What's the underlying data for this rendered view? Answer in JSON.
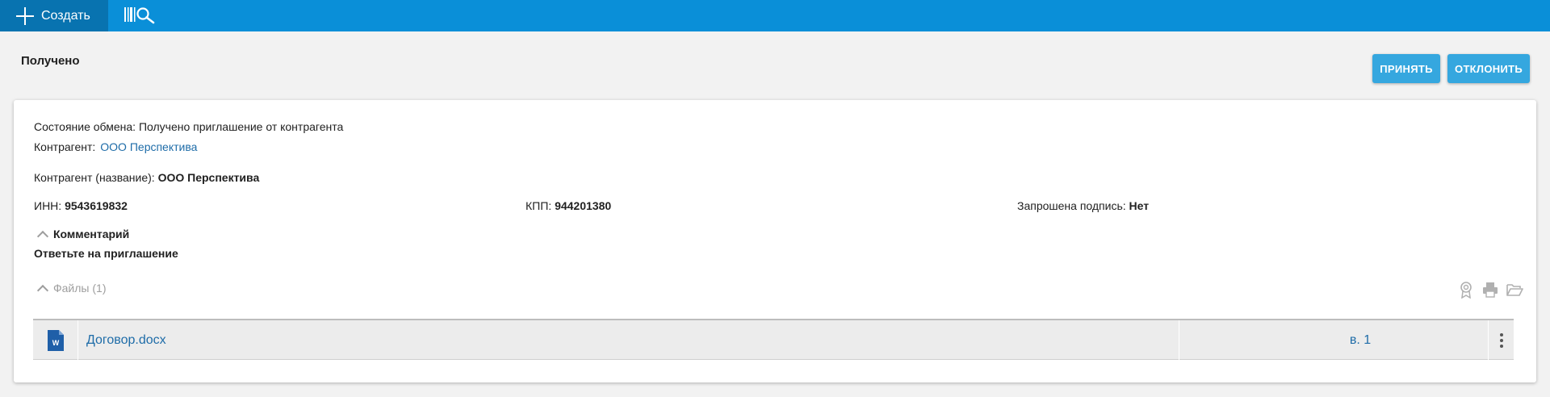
{
  "topbar": {
    "create_label": "Создать",
    "create_icon": "plus-icon",
    "barcode_icon": "barcode-search-icon",
    "background": "#0a8fd8",
    "create_background": "#0873b0"
  },
  "header": {
    "status_title": "Получено",
    "accept_label": "ПРИНЯТЬ",
    "reject_label": "ОТКЛОНИТЬ",
    "button_color": "#35a7df"
  },
  "details": {
    "exchange_state_label": "Состояние обмена:",
    "exchange_state_value": "Получено приглашение от контрагента",
    "counterparty_label": "Контрагент:",
    "counterparty_link": "ООО Перспектива",
    "counterparty_name_label": "Контрагент (название):",
    "counterparty_name_value": "ООО Перспектива",
    "inn_label": "ИНН:",
    "inn_value": "9543619832",
    "kpp_label": "КПП:",
    "kpp_value": "944201380",
    "signature_label": "Запрошена подпись:",
    "signature_value": "Нет"
  },
  "comment": {
    "toggle_label": "Комментарий",
    "text": "Ответьте на приглашение"
  },
  "files": {
    "toggle_label": "Файлы (1)",
    "tool_icons": [
      "certificate-icon",
      "printer-icon",
      "folder-open-icon"
    ],
    "rows": [
      {
        "icon": "word-document-icon",
        "name": "Договор.docx",
        "version": "в. 1"
      }
    ]
  }
}
